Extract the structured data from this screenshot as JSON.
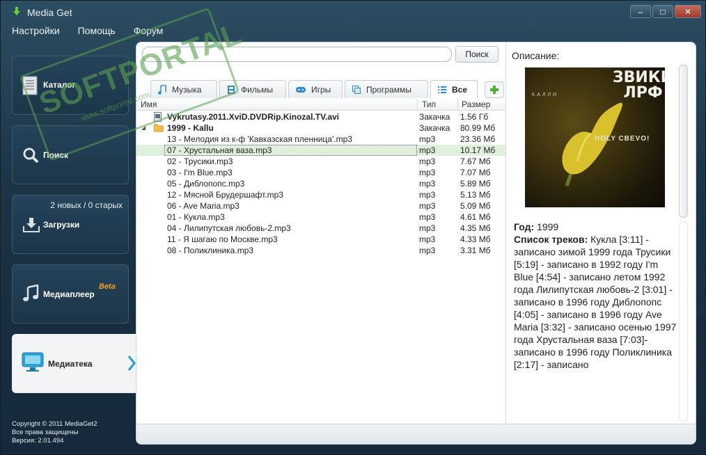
{
  "window": {
    "title": "Media Get",
    "min": "‒",
    "max": "□",
    "close": "✕"
  },
  "menu": [
    "Настройки",
    "Помощь",
    "Форум"
  ],
  "sidebar": {
    "catalog": "Каталог",
    "search": "Поиск",
    "downloads": "Загрузки",
    "downloads_note": "2 новых / 0 старых",
    "player": "Медиаплеер",
    "player_badge": "Beta",
    "library": "Медиатека"
  },
  "footer": {
    "line1": "Copyright © 2011 MediaGet2",
    "line2": "Все права защищены",
    "line3": "Версия: 2.01.494"
  },
  "search": {
    "button": "Поиск",
    "value": ""
  },
  "tabs": [
    "Музыка",
    "Фильмы",
    "Игры",
    "Программы",
    "Все"
  ],
  "columns": {
    "name": "Имя",
    "type": "Тип",
    "size": "Размер"
  },
  "rows": [
    {
      "name": "Vykrutasy.2011.XviD.DVDRip.Kinozal.TV.avi",
      "type": "Закачка",
      "size": "1.56 Гб"
    },
    {
      "name": "1999 - Kallu",
      "type": "Закачка",
      "size": "80.99 Мб"
    },
    {
      "name": "13 - Мелодия из к-ф 'Кавказская пленница'.mp3",
      "type": "mp3",
      "size": "23.36 Мб"
    },
    {
      "name": "07 - Хрустальная ваза.mp3",
      "type": "mp3",
      "size": "10.17 Мб"
    },
    {
      "name": "02 - Трусики.mp3",
      "type": "mp3",
      "size": "7.67 Мб"
    },
    {
      "name": "03 - I'm Blue.mp3",
      "type": "mp3",
      "size": "7.07 Мб"
    },
    {
      "name": "05 - Диблопопс.mp3",
      "type": "mp3",
      "size": "5.89 Мб"
    },
    {
      "name": "12 - Мясной Брудершафт.mp3",
      "type": "mp3",
      "size": "5.13 Мб"
    },
    {
      "name": "06 - Ave Maria.mp3",
      "type": "mp3",
      "size": "5.09 Мб"
    },
    {
      "name": "01 - Кукла.mp3",
      "type": "mp3",
      "size": "4.61 Мб"
    },
    {
      "name": "04 - Лилипутская любовь-2.mp3",
      "type": "mp3",
      "size": "4.35 Мб"
    },
    {
      "name": "11 - Я шагаю по Москве.mp3",
      "type": "mp3",
      "size": "4.33 Мб"
    },
    {
      "name": "08 - Поликлиника.mp3",
      "type": "mp3",
      "size": "3.31 Мб"
    }
  ],
  "description": {
    "title": "Описание:",
    "cover_logo": "ЗВИКИ\nЛРФ",
    "cover_line": "КАЛЛИ",
    "cover_label": "HOLY CBEVO!",
    "year_label": "Год:",
    "year": "1999",
    "tracks_label": "Список треков:",
    "tracks_text": "Кукла [3:11] - записано зимой 1999 года Трусики [5:19] - записано в 1992 году I'm Blue [4:54] - записано летом 1992 года Лилипутская любовь-2 [3:01] - записано в 1996 году Диблопопс [4:05] - записано в 1996 году Ave Maria [3:32] - записано осенью 1997 года Хрустальная ваза [7:03]- записано в 1996 году Поликлиника [2:17] - записано"
  },
  "watermark": {
    "big": "SOFTPORTAL",
    "small": "www.softportal.com"
  }
}
